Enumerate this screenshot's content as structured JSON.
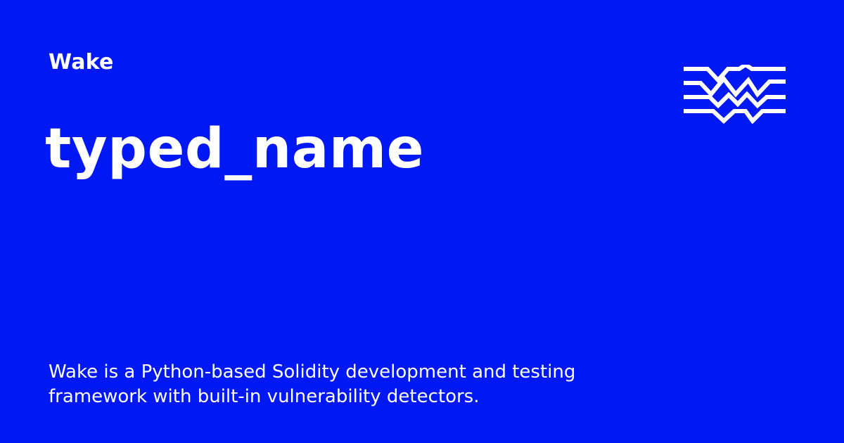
{
  "brand": {
    "name": "Wake"
  },
  "page": {
    "title": "typed_name",
    "description": "Wake is a Python-based Solidity development and testing framework with built-in vulnerability detectors."
  },
  "logo": {
    "icon": "wake-waves-logo-icon",
    "color": "#FFFFFF"
  },
  "colors": {
    "background": "#0019F4",
    "text": "#FFFFFF"
  }
}
